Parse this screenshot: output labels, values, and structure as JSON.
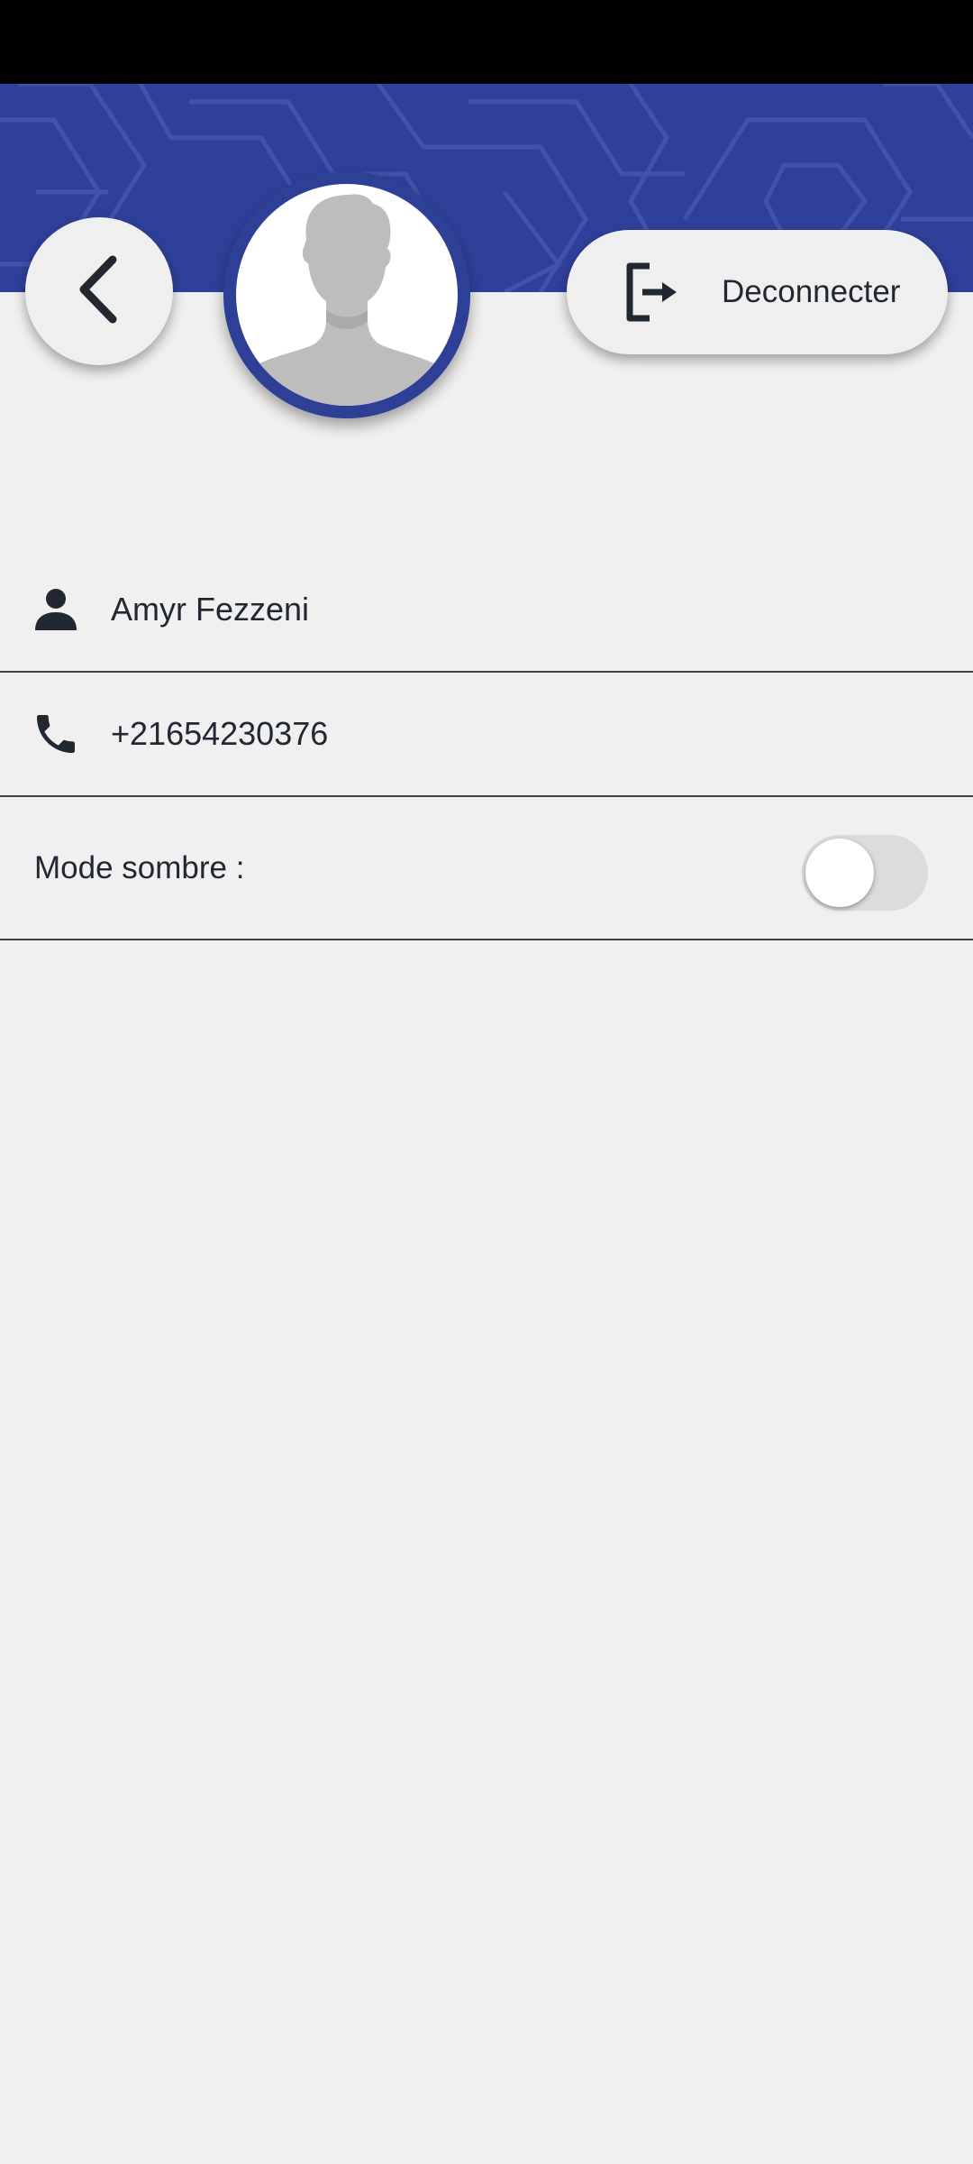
{
  "header": {
    "banner_color": "#2f409a",
    "back_icon": "chevron-left-icon",
    "avatar_icon": "default-user-silhouette-icon",
    "logout": {
      "icon": "logout-arrow-icon",
      "label": "Deconnecter"
    }
  },
  "profile": {
    "name": {
      "icon": "person-icon",
      "value": "Amyr Fezzeni"
    },
    "phone": {
      "icon": "phone-icon",
      "value": "+21654230376"
    },
    "dark_mode": {
      "label": "Mode sombre :",
      "enabled": false
    }
  },
  "colors": {
    "accent": "#2e3f96",
    "background": "#f0f0f0",
    "text": "#222831",
    "divider": "#3a3f4a"
  }
}
